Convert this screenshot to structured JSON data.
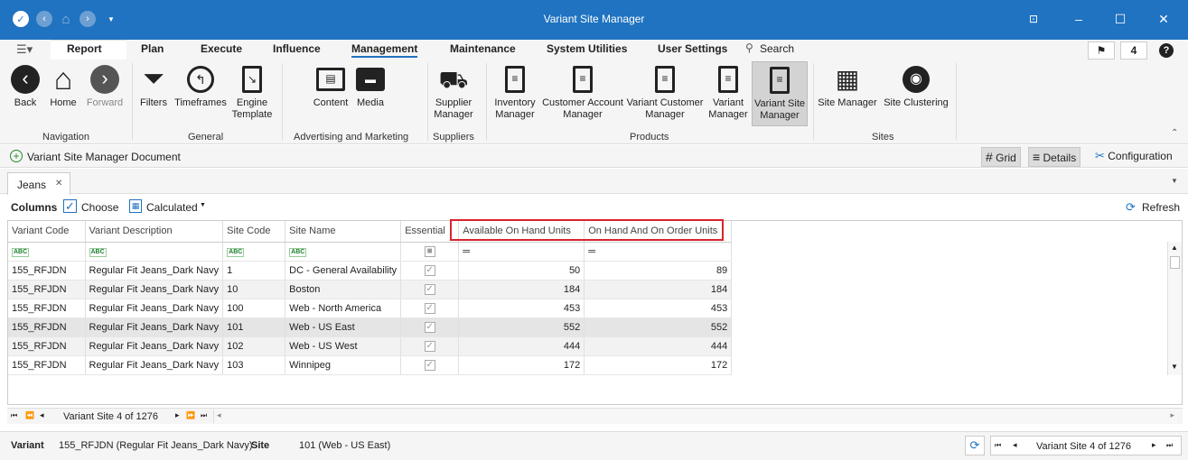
{
  "window": {
    "title": "Variant Site Manager"
  },
  "menu": {
    "items": [
      "Report",
      "Plan",
      "Execute",
      "Influence",
      "Management",
      "Maintenance",
      "System Utilities",
      "User Settings"
    ],
    "active": "Management",
    "search_label": "Search",
    "badge_count": "4",
    "help_label": "?"
  },
  "ribbon": {
    "navigation": {
      "label": "Navigation",
      "back": "Back",
      "home": "Home",
      "forward": "Forward"
    },
    "general": {
      "label": "General",
      "filters": "Filters",
      "timeframes": "Timeframes",
      "engine_template": "Engine Template"
    },
    "advertising": {
      "label": "Advertising and Marketing",
      "content": "Content",
      "media": "Media"
    },
    "suppliers": {
      "label": "Suppliers",
      "supplier_manager": "Supplier Manager"
    },
    "products": {
      "label": "Products",
      "inventory_manager": "Inventory Manager",
      "customer_account_manager": "Customer Account Manager",
      "variant_customer_manager": "Variant Customer Manager",
      "variant_manager": "Variant Manager",
      "variant_site_manager": "Variant Site Manager"
    },
    "sites": {
      "label": "Sites",
      "site_manager": "Site Manager",
      "site_clustering": "Site Clustering"
    }
  },
  "docbar": {
    "title": "Variant Site Manager Document",
    "grid": "Grid",
    "details": "Details",
    "configuration": "Configuration"
  },
  "tab": {
    "label": "Jeans"
  },
  "columns_toolbar": {
    "columns": "Columns",
    "choose": "Choose",
    "calculated": "Calculated",
    "refresh": "Refresh"
  },
  "grid": {
    "headers": [
      "Variant Code",
      "Variant Description",
      "Site Code",
      "Site Name",
      "Essential",
      "Available On Hand Units",
      "On Hand And On Order Units"
    ],
    "rows": [
      [
        "155_RFJDN",
        "Regular Fit Jeans_Dark Navy",
        "1",
        "DC - General Availability",
        "50",
        "89"
      ],
      [
        "155_RFJDN",
        "Regular Fit Jeans_Dark Navy",
        "10",
        "Boston",
        "184",
        "184"
      ],
      [
        "155_RFJDN",
        "Regular Fit Jeans_Dark Navy",
        "100",
        "Web - North America",
        "453",
        "453"
      ],
      [
        "155_RFJDN",
        "Regular Fit Jeans_Dark Navy",
        "101",
        "Web - US East",
        "552",
        "552"
      ],
      [
        "155_RFJDN",
        "Regular Fit Jeans_Dark Navy",
        "102",
        "Web - US West",
        "444",
        "444"
      ],
      [
        "155_RFJDN",
        "Regular Fit Jeans_Dark Navy",
        "103",
        "Winnipeg",
        "172",
        "172"
      ]
    ],
    "highlight_color": "#d9232d"
  },
  "navigator": {
    "position": "Variant Site 4 of 1276"
  },
  "status": {
    "variant_label": "Variant",
    "variant_value": "155_RFJDN (Regular Fit Jeans_Dark Navy)",
    "site_label": "Site",
    "site_value": "101 (Web - US East)",
    "position": "Variant Site 4 of 1276"
  }
}
